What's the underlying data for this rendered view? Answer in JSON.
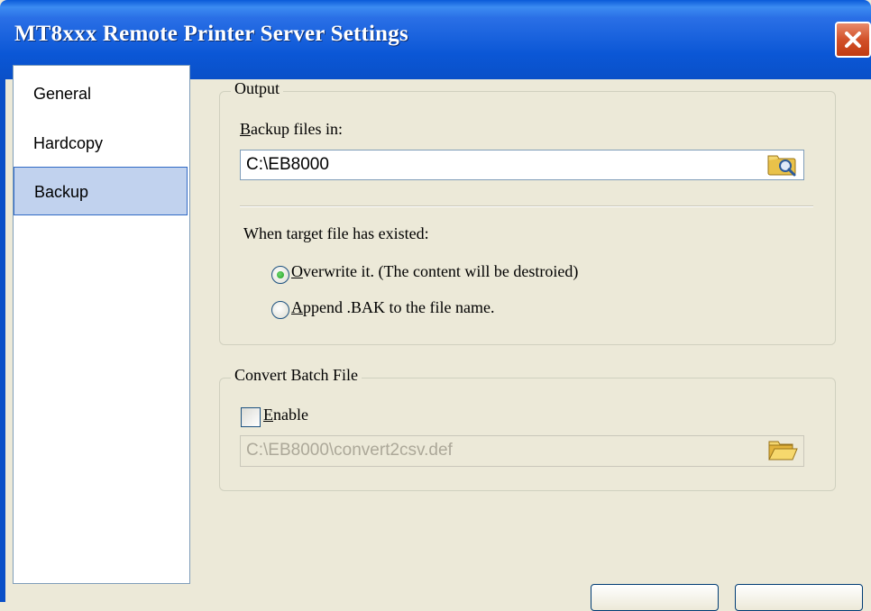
{
  "window": {
    "title": "MT8xxx Remote Printer Server Settings"
  },
  "sidebar": {
    "items": [
      {
        "label": "General",
        "selected": false
      },
      {
        "label": "Hardcopy",
        "selected": false
      },
      {
        "label": "Backup",
        "selected": true
      }
    ]
  },
  "output": {
    "legend": "Output",
    "backup_label_prefix": "B",
    "backup_label_rest": "ackup files in:",
    "backup_path": "C:\\EB8000",
    "existing_label": "When target file has existed:",
    "options": [
      {
        "accel": "O",
        "rest": "verwrite it. (The content will be destroied)",
        "checked": true
      },
      {
        "accel": "A",
        "rest": "ppend .BAK to the file name.",
        "checked": false
      }
    ]
  },
  "convert": {
    "legend": "Convert Batch File",
    "enable_accel": "E",
    "enable_rest": "nable",
    "enabled": false,
    "path": "C:\\EB8000\\convert2csv.def"
  },
  "colors": {
    "titlebar": "#0a50c8",
    "selection": "#c1d2ee",
    "background": "#ece9d8"
  },
  "icons": {
    "close": "close-icon",
    "browse_folder": "browse-folder-icon",
    "open_folder": "open-folder-icon"
  }
}
